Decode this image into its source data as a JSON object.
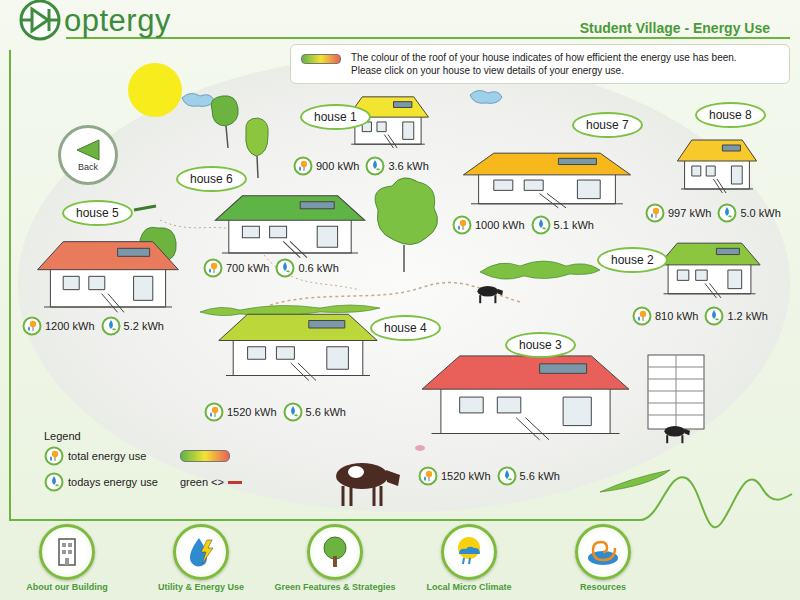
{
  "logo": {
    "text": "optergy"
  },
  "header": {
    "title": "Student Village - Energy Use"
  },
  "info": {
    "lines": [
      "The colour of the roof of your house indicates of how efficient the energy use has been.",
      "Please click on your house to view details of your energy use."
    ]
  },
  "back_button": {
    "label": "Back"
  },
  "houses": [
    {
      "name": "house 1",
      "total": "900 kWh",
      "today": "3.6 kWh",
      "color": "#f3e431"
    },
    {
      "name": "house 2",
      "total": "810 kWh",
      "today": "1.2 kWh",
      "color": "#8cc63f"
    },
    {
      "name": "house 3",
      "total": "1520 kWh",
      "today": "5.6 kWh",
      "color": "#e9605a"
    },
    {
      "name": "house 4",
      "total": "1520 kWh",
      "today": "5.6 kWh",
      "color": "#bcd73a"
    },
    {
      "name": "house 5",
      "total": "1200 kWh",
      "today": "5.2 kWh",
      "color": "#ea7a5c"
    },
    {
      "name": "house 6",
      "total": "700 kWh",
      "today": "0.6 kWh",
      "color": "#5fb446"
    },
    {
      "name": "house 7",
      "total": "1000 kWh",
      "today": "5.1 kWh",
      "color": "#f6b81c"
    },
    {
      "name": "house 8",
      "total": "997 kWh",
      "today": "5.0 kWh",
      "color": "#f8c92a"
    }
  ],
  "legend": {
    "title": "Legend",
    "items": [
      {
        "label": "total energy use"
      },
      {
        "label": "todays energy use"
      }
    ],
    "scale_label": "green <>"
  },
  "nav": [
    {
      "label": "About our Building"
    },
    {
      "label": "Utility & Energy Use"
    },
    {
      "label": "Green Features & Strategies"
    },
    {
      "label": "Local Micro Climate"
    },
    {
      "label": "Resources"
    }
  ]
}
